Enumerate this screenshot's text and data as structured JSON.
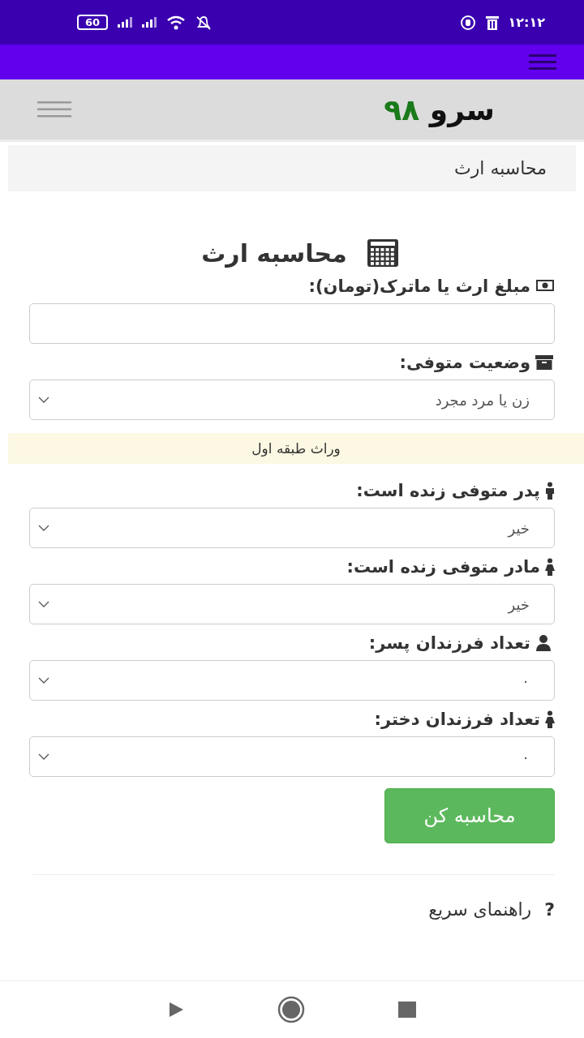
{
  "status_bar": {
    "time": "۱۲:۱۲",
    "battery": "60"
  },
  "header": {
    "logo_text": "سرو",
    "logo_number": "۹۸"
  },
  "breadcrumb": "محاسبه ارث",
  "title": "محاسبه ارث",
  "form": [
    {
      "kind": "input",
      "label": "مبلغ ارث یا ماترک(تومان):"
    },
    {
      "kind": "select",
      "label": "وضعیت متوفی:",
      "value": "زن یا مرد مجرد"
    },
    {
      "kind": "banner",
      "label": "وراث طبقه اول"
    },
    {
      "kind": "select",
      "label": "پدر متوفی زنده است:",
      "value": "خیر"
    },
    {
      "kind": "select",
      "label": "مادر متوفی زنده است:",
      "value": "خیر"
    },
    {
      "kind": "select",
      "label": "تعداد فرزندان پسر:",
      "value": "۰"
    },
    {
      "kind": "select",
      "label": "تعداد فرزندان دختر:",
      "value": "۰"
    }
  ],
  "submit_button": "محاسبه کن",
  "help": {
    "icon": "?",
    "title": "راهنمای سریع"
  }
}
